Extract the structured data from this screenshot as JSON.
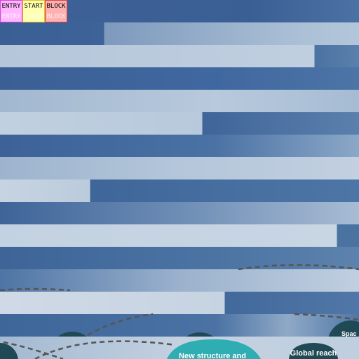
{
  "markers": [
    {
      "label": "ENTRY",
      "color": "#ffb8ff"
    },
    {
      "label": "START",
      "color": "#ffffb0"
    },
    {
      "label": "BLOCK",
      "color": "#ffb0b0"
    }
  ],
  "diagram": {
    "nodes": [
      {
        "label": "New structure and",
        "color": "#2eadb3"
      },
      {
        "label": "Global reach",
        "color": "#1f4a55"
      },
      {
        "label": "Spac",
        "color": "#1f4a55"
      }
    ]
  }
}
